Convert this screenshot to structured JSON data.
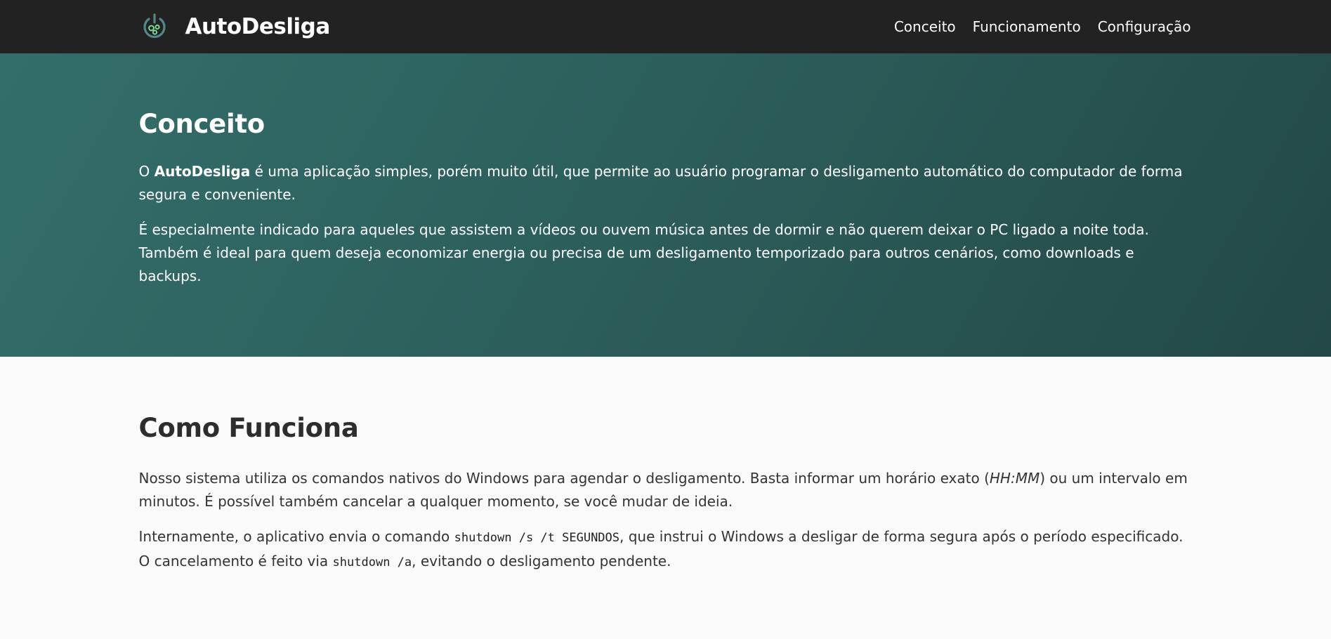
{
  "header": {
    "brand_name": "AutoDesliga",
    "logo_icon": "power-gear-icon",
    "nav": [
      "Conceito",
      "Funcionamento",
      "Configuração"
    ]
  },
  "concept": {
    "title": "Conceito",
    "p1_prefix": "O ",
    "p1_strong": "AutoDesliga",
    "p1_suffix": " é uma aplicação simples, porém muito útil, que permite ao usuário programar o desligamento automático do computador de forma segura e conveniente.",
    "p2": "É especialmente indicado para aqueles que assistem a vídeos ou ouvem música antes de dormir e não querem deixar o PC ligado a noite toda. Também é ideal para quem deseja economizar energia ou precisa de um desligamento temporizado para outros cenários, como downloads e backups."
  },
  "how": {
    "title": "Como Funciona",
    "p1_a": "Nosso sistema utiliza os comandos nativos do Windows para agendar o desligamento. Basta informar um horário exato (",
    "p1_em": "HH:MM",
    "p1_b": ") ou um intervalo em minutos. É possível também cancelar a qualquer momento, se você mudar de ideia.",
    "p2_a": "Internamente, o aplicativo envia o comando ",
    "p2_code1": "shutdown /s /t SEGUNDOS",
    "p2_b": ", que instrui o Windows a desligar de forma segura após o período especificado. O cancelamento é feito via ",
    "p2_code2": "shutdown /a",
    "p2_c": ", evitando o desligamento pendente."
  },
  "colors": {
    "topbar": "#222222",
    "hero_start": "#336e6b",
    "hero_end": "#234846",
    "logo_green": "#7bd88f",
    "logo_teal": "#4f8a86"
  }
}
